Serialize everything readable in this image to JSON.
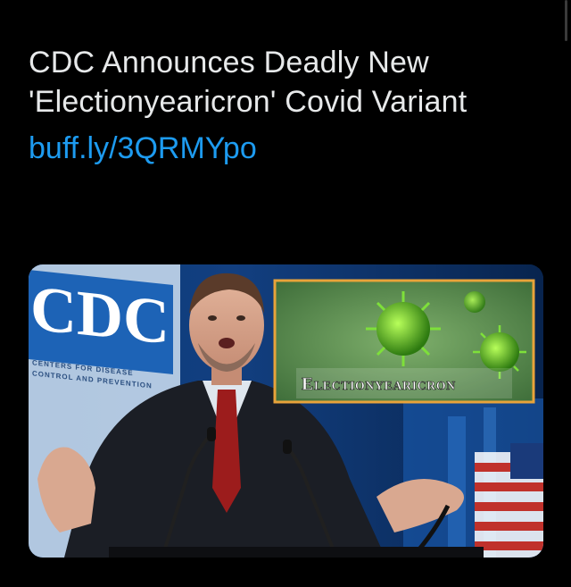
{
  "tweet": {
    "text": "CDC Announces Deadly New 'Electionyearicron' Covid Variant",
    "link": "buff.ly/3QRMYpo"
  },
  "media": {
    "logo_text": "CDC",
    "logo_tagline_1": "CENTERS FOR DISEASE",
    "logo_tagline_2": "CONTROL AND PREVENTION",
    "inset_label": "Electionyearicron"
  },
  "colors": {
    "link": "#1d9bf0",
    "background": "#000000",
    "inset_border": "#e8a33a"
  }
}
